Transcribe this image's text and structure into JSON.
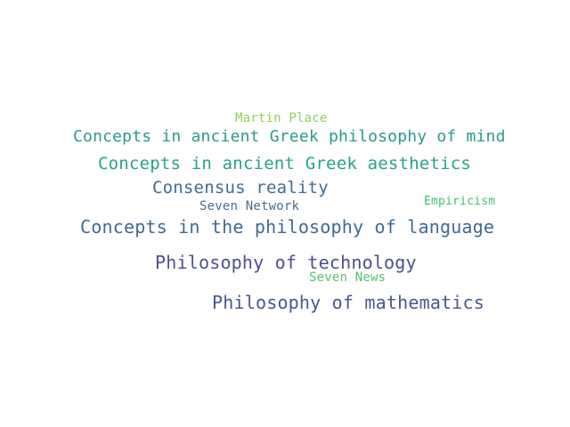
{
  "word_cloud": {
    "words": [
      {
        "text": "Martin Place",
        "color": "#8fd15a"
      },
      {
        "text": "Concepts in ancient Greek philosophy of mind",
        "color": "#2a9a8f"
      },
      {
        "text": "Concepts in ancient Greek aesthetics",
        "color": "#27a287"
      },
      {
        "text": "Consensus reality",
        "color": "#3e6e96"
      },
      {
        "text": "Seven Network",
        "color": "#4a6d8f"
      },
      {
        "text": "Empiricism",
        "color": "#3fbf71"
      },
      {
        "text": "Concepts in the philosophy of language",
        "color": "#3f6a94"
      },
      {
        "text": "Philosophy of technology",
        "color": "#4f4f8f"
      },
      {
        "text": "Seven News",
        "color": "#55c26a"
      },
      {
        "text": "Philosophy of mathematics",
        "color": "#4b568d"
      }
    ]
  }
}
